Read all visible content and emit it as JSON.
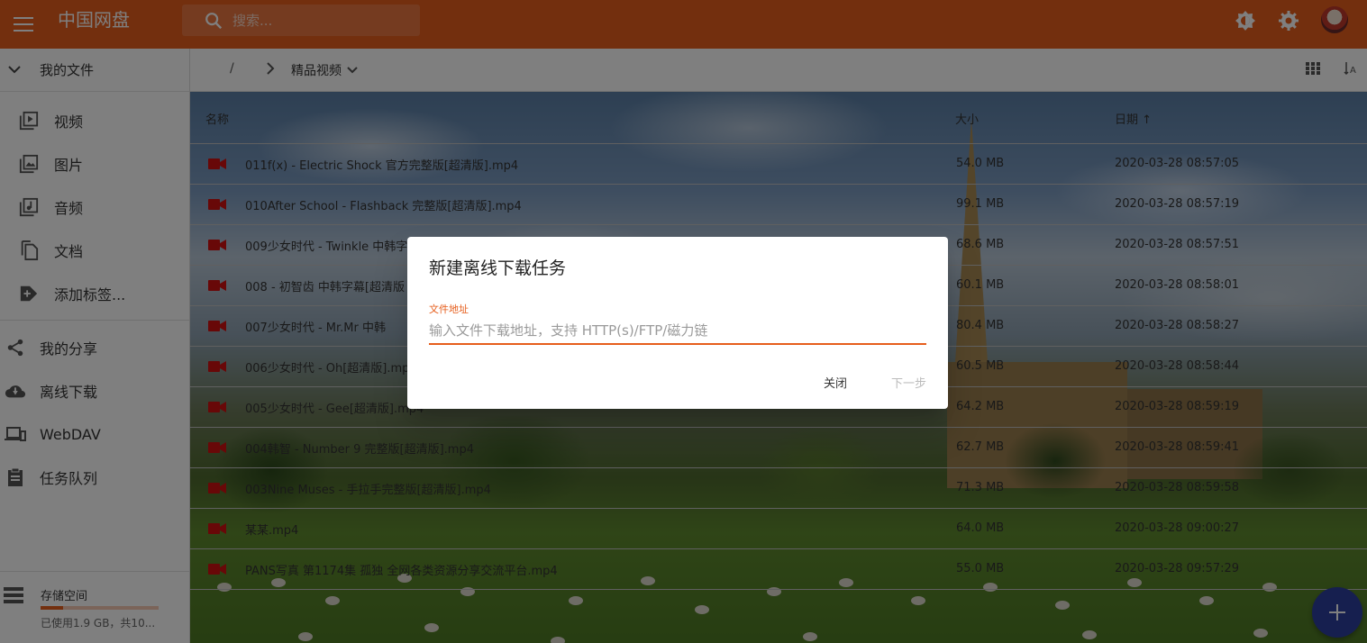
{
  "app": {
    "title": "中国网盘",
    "accent": "#e65e1c"
  },
  "search": {
    "placeholder": "搜索..."
  },
  "sidebar": {
    "my_files": "我的文件",
    "sub_items": [
      {
        "label": "视频",
        "icon": "video-library-icon"
      },
      {
        "label": "图片",
        "icon": "image-icon"
      },
      {
        "label": "音频",
        "icon": "music-library-icon"
      },
      {
        "label": "文档",
        "icon": "file-copy-icon"
      },
      {
        "label": "添加标签...",
        "icon": "tag-plus-icon"
      }
    ],
    "items": [
      {
        "label": "我的分享",
        "icon": "share-icon"
      },
      {
        "label": "离线下载",
        "icon": "cloud-download-icon"
      },
      {
        "label": "WebDAV",
        "icon": "devices-icon"
      },
      {
        "label": "任务队列",
        "icon": "clipboard-icon"
      }
    ],
    "storage": {
      "title": "存储空间",
      "used": "已使用1.9 GB，共10...",
      "used_fraction": 0.19
    }
  },
  "breadcrumb": {
    "root": "/",
    "current": "精品视频"
  },
  "table": {
    "headers": {
      "name": "名称",
      "size": "大小",
      "date": "日期 ↑"
    },
    "rows": [
      {
        "name": "011f(x) - Electric Shock 官方完整版[超清版].mp4",
        "size": "54.0 MB",
        "date": "2020-03-28 08:57:05"
      },
      {
        "name": "010After School - Flashback 完整版[超清版].mp4",
        "size": "99.1 MB",
        "date": "2020-03-28 08:57:19"
      },
      {
        "name": "009少女时代 - Twinkle 中韩字幕",
        "size": "68.6 MB",
        "date": "2020-03-28 08:57:51"
      },
      {
        "name": "008 - 初智齿 中韩字幕[超清版",
        "size": "60.1 MB",
        "date": "2020-03-28 08:58:01"
      },
      {
        "name": "007少女时代 - Mr.Mr 中韩",
        "size": "80.4 MB",
        "date": "2020-03-28 08:58:27"
      },
      {
        "name": "006少女时代 - Oh[超清版].mp4",
        "size": "60.5 MB",
        "date": "2020-03-28 08:58:44"
      },
      {
        "name": "005少女时代 - Gee[超清版].mp4",
        "size": "64.2 MB",
        "date": "2020-03-28 08:59:19"
      },
      {
        "name": "004韩智 - Number 9 完整版[超清版].mp4",
        "size": "62.7 MB",
        "date": "2020-03-28 08:59:41"
      },
      {
        "name": "003Nine Muses - 手拉手完整版[超清版].mp4",
        "size": "71.3 MB",
        "date": "2020-03-28 08:59:58"
      },
      {
        "name": "某某.mp4",
        "size": "64.0 MB",
        "date": "2020-03-28 09:00:27"
      },
      {
        "name": "PANS写真 第1174集 孤独 全网各类资源分享交流平台.mp4",
        "size": "55.0 MB",
        "date": "2020-03-28 09:57:29"
      }
    ]
  },
  "dialog": {
    "title": "新建离线下载任务",
    "field_label": "文件地址",
    "field_placeholder": "输入文件下载地址，支持 HTTP(s)/FTP/磁力链",
    "field_value": "",
    "close_label": "关闭",
    "next_label": "下一步"
  },
  "fab": {
    "icon": "add-icon"
  }
}
